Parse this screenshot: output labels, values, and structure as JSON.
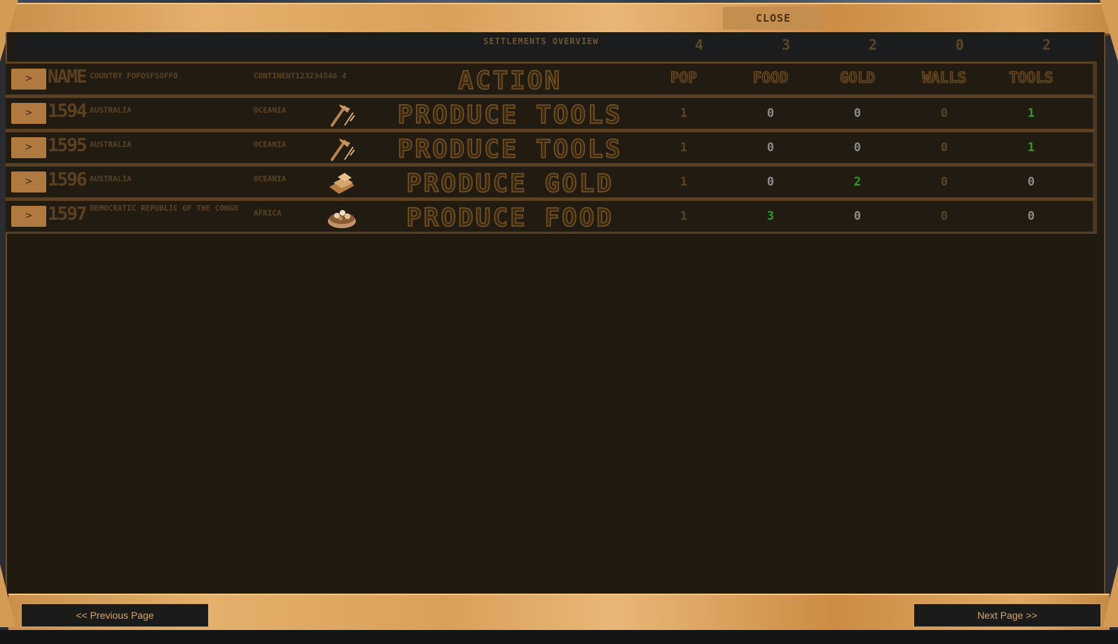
{
  "window": {
    "close_label": "CLOSE"
  },
  "overview": {
    "title": "SETTLEMENTS OVERVIEW",
    "totals": {
      "pop": "4",
      "food": "3",
      "gold": "2",
      "walls": "0",
      "tools": "2"
    }
  },
  "table": {
    "headers": {
      "expand": ">",
      "name": "NAME",
      "country": "COUNTRY FOFOSFSOFFO",
      "continent": "CONTINENT123234546 4",
      "action": "ACTION",
      "pop": "POP",
      "food": "FOOD",
      "gold": "GOLD",
      "walls": "WALLS",
      "tools": "TOOLS"
    },
    "rows": [
      {
        "expand": ">",
        "name": "1594",
        "country": "AUSTRALIA",
        "continent": "OCEANIA",
        "action_icon": "hammer-icon",
        "action": "PRODUCE TOOLS",
        "pop": "1",
        "food": "0",
        "gold": "0",
        "walls": "0",
        "tools": "1"
      },
      {
        "expand": ">",
        "name": "1595",
        "country": "AUSTRALIA",
        "continent": "OCEANIA",
        "action_icon": "hammer-icon",
        "action": "PRODUCE TOOLS",
        "pop": "1",
        "food": "0",
        "gold": "0",
        "walls": "0",
        "tools": "1"
      },
      {
        "expand": ">",
        "name": "1596",
        "country": "AUSTRALIA",
        "continent": "OCEANIA",
        "action_icon": "gold-bar-icon",
        "action": "PRODUCE GOLD",
        "pop": "1",
        "food": "0",
        "gold": "2",
        "walls": "0",
        "tools": "0"
      },
      {
        "expand": ">",
        "name": "1597",
        "country": "DEMOCRATIC REPUBLIC OF THE CONGO",
        "continent": "AFRICA",
        "action_icon": "food-basket-icon",
        "action": "PRODUCE FOOD",
        "pop": "1",
        "food": "3",
        "gold": "0",
        "walls": "0",
        "tools": "0"
      }
    ]
  },
  "pagination": {
    "prev_label": "<< Previous Page",
    "next_label": "Next Page >>"
  },
  "colors": {
    "frame_gold": "#d9a05a",
    "panel_bg": "#211a11",
    "positive_green": "#2e9b2a",
    "zero_grey": "#8a8a8a"
  }
}
